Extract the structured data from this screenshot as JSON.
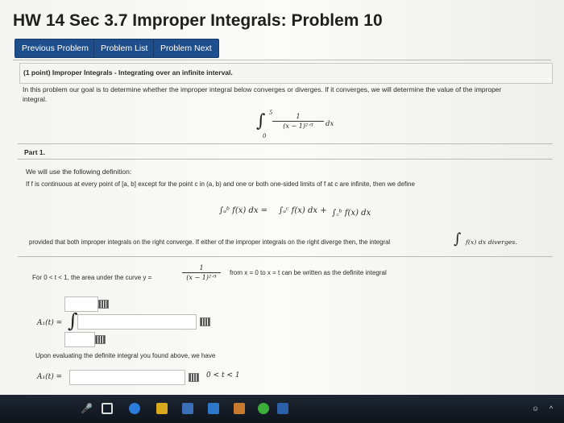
{
  "header": {
    "title": "HW 14 Sec 3.7 Improper Integrals: Problem 10"
  },
  "nav": {
    "previous": "Previous Problem",
    "list": "Problem List",
    "next": "Problem Next"
  },
  "problem": {
    "heading": "(1 point) Improper Integrals - Integrating over an infinite interval.",
    "intro_line1": "In this problem our goal is to determine whether the improper integral below converges or diverges. If it converges, we will determine the value of the improper",
    "intro_line2": "integral.",
    "integral_upper": "5",
    "integral_lower": "0",
    "integrand_num": "1",
    "integrand_den": "(x − 1)²ᐟ³",
    "integrand_dx": "dx"
  },
  "part1": {
    "label": "Part 1.",
    "definition_intro": "We will use the following definition:",
    "definition_text": "If f is continuous at every point of [a, b] except for the point c in (a, b) and one or both one-sided limits of f at c are infinite, then we define",
    "def_eq_left": "∫ₐᵇ f(x) dx =",
    "def_eq_mid": "∫ₐᶜ f(x) dx +",
    "def_eq_right": "∫꜀ᵇ f(x) dx",
    "provided_text": "provided that both improper integrals on the right converge. If either of the improper integrals on the right diverge then, the integral",
    "provided_tail": "f(x) dx diverges.",
    "for_text": "For 0 < t < 1, the area under the curve y =",
    "curve_num": "1",
    "curve_den": "(x − 1)²ᐟ³",
    "from_text": "from x = 0 to x = t can be written as the definite integral",
    "a1_label": "A₁(t) =",
    "upon_text": "Upon evaluating the definite integral you found above, we have",
    "a1_label2": "A₁(t) =",
    "range_text": "0 < t < 1"
  },
  "colors": {
    "button_bg": "#1f4e8c",
    "page_bg": "#f7f7f5",
    "taskbar_bg": "#121820"
  }
}
